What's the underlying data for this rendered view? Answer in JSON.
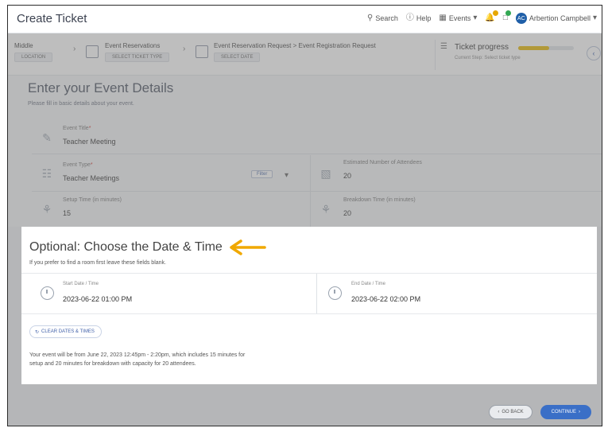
{
  "header": {
    "title": "Create Ticket",
    "search_label": "Search",
    "help_label": "Help",
    "events_label": "Events",
    "user_name": "Arbertion Campbell",
    "avatar_initials": "AC",
    "notif_colors": [
      "#e6a700",
      "#33a853"
    ]
  },
  "stepper": {
    "steps": [
      {
        "title": "Middle",
        "sub": "LOCATION"
      },
      {
        "title": "Event Reservations",
        "sub": "SELECT TICKET TYPE"
      },
      {
        "title": "Event Reservation Request > Event Registration Request",
        "sub": "SELECT DATE"
      }
    ],
    "progress": {
      "title": "Ticket progress",
      "sub": "Current Step: Select ticket type",
      "fraction": 0.55,
      "color": "#e6b800"
    }
  },
  "details": {
    "heading": "Enter your Event Details",
    "subheading": "Please fill in basic details about your event.",
    "event_title_label": "Event Title",
    "event_title_value": "Teacher Meeting",
    "event_type_label": "Event Type",
    "event_type_value": "Teacher Meetings",
    "event_type_chip": "Filter",
    "attendees_label": "Estimated Number of Attendees",
    "attendees_value": "20",
    "setup_label": "Setup Time (in minutes)",
    "setup_value": "15",
    "breakdown_label": "Breakdown Time (in minutes)",
    "breakdown_value": "20"
  },
  "datetime": {
    "title": "Optional: Choose the Date & Time",
    "subtitle": "If you prefer to find a room first leave these fields blank.",
    "start_label": "Start Date / Time",
    "start_value": "2023-06-22 01:00 PM",
    "end_label": "End Date / Time",
    "end_value": "2023-06-22 02:00 PM",
    "clear_label": "CLEAR DATES & TIMES",
    "summary_line1": "Your event will be from June 22, 2023 12:45pm - 2:20pm, which includes 15 minutes for",
    "summary_line2": "setup and 20 minutes for breakdown with capacity for 20 attendees.",
    "arrow_color": "#f0a800"
  },
  "actions": {
    "back_label": "GO BACK",
    "continue_label": "CONTINUE"
  }
}
